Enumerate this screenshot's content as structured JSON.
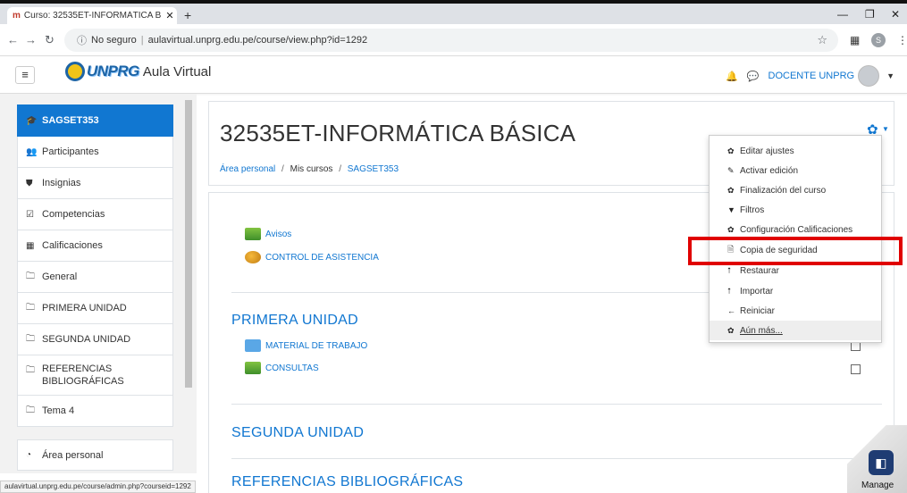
{
  "browser": {
    "tab_title": "Curso: 32535ET-INFORMÁTICA B",
    "tab_favicon": "m",
    "new_tab": "+",
    "security_label": "No seguro",
    "url": "aulavirtual.unprg.edu.pe/course/view.php?id=1292",
    "profile_initial": "S",
    "status_url": "aulavirtual.unprg.edu.pe/course/admin.php?courseid=1292"
  },
  "navbar": {
    "brand": "UNPRG",
    "app_name": "Aula Virtual",
    "user_name": "DOCENTE UNPRG"
  },
  "sidebar": {
    "items": [
      {
        "label": "SAGSET353",
        "icon": "graduation-cap-icon",
        "glyph": "🎓"
      },
      {
        "label": "Participantes",
        "icon": "users-icon",
        "glyph": "👥"
      },
      {
        "label": "Insignias",
        "icon": "shield-icon",
        "glyph": "⛊"
      },
      {
        "label": "Competencias",
        "icon": "check-square-icon",
        "glyph": "☑"
      },
      {
        "label": "Calificaciones",
        "icon": "table-icon",
        "glyph": "▦"
      },
      {
        "label": "General",
        "icon": "folder-icon",
        "glyph": "🗀"
      },
      {
        "label": "PRIMERA UNIDAD",
        "icon": "folder-icon",
        "glyph": "🗀"
      },
      {
        "label": "SEGUNDA UNIDAD",
        "icon": "folder-icon",
        "glyph": "🗀"
      },
      {
        "label": "REFERENCIAS BIBLIOGRÁFICAS",
        "icon": "folder-icon",
        "glyph": "🗀"
      },
      {
        "label": "Tema 4",
        "icon": "folder-icon",
        "glyph": "🗀"
      },
      {
        "label": "Área personal",
        "icon": "tachometer-icon",
        "glyph": "◔"
      }
    ]
  },
  "course": {
    "title": "32535ET-INFORMÁTICA BÁSICA",
    "breadcrumb": [
      "Área personal",
      "Mis cursos",
      "SAGSET353"
    ],
    "breadcrumb_sep": "/"
  },
  "content": {
    "general_activities": [
      "Avisos",
      "CONTROL DE ASISTENCIA"
    ],
    "sections": [
      {
        "title": "PRIMERA UNIDAD",
        "activities": [
          "MATERIAL DE TRABAJO",
          "CONSULTAS"
        ]
      },
      {
        "title": "SEGUNDA UNIDAD",
        "activities": []
      },
      {
        "title": "REFERENCIAS BIBLIOGRÁFICAS",
        "activities": []
      }
    ]
  },
  "menu": {
    "items": [
      {
        "label": "Editar ajustes",
        "glyph": "✿"
      },
      {
        "label": "Activar edición",
        "glyph": "✎"
      },
      {
        "label": "Finalización del curso",
        "glyph": "✿"
      },
      {
        "label": "Filtros",
        "glyph": "▼"
      },
      {
        "label": "Configuración Calificaciones",
        "glyph": "✿"
      },
      {
        "label": "Copia de seguridad",
        "glyph": "🗎"
      },
      {
        "label": "Restaurar",
        "glyph": "⭡"
      },
      {
        "label": "Importar",
        "glyph": "⭡"
      },
      {
        "label": "Reiniciar",
        "glyph": "←"
      },
      {
        "label": "Aún más...",
        "glyph": "✿"
      }
    ]
  },
  "manage": {
    "label": "Manage"
  },
  "colors": {
    "accent": "#1177d1",
    "highlight": "#e00000"
  }
}
